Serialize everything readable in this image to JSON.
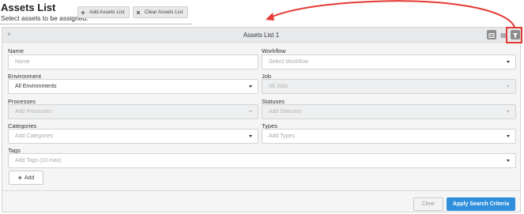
{
  "page": {
    "title": "Assets List",
    "subtitle": "Select assets to be assigned.",
    "add_assets_list_label": "Add Assets List",
    "add_glyph": "+",
    "clear_assets_list_label": "Clear Assets List",
    "clear_glyph": "×"
  },
  "panel": {
    "title": "Assets List 1",
    "close_glyph": "×",
    "fields": {
      "name": {
        "label": "Name",
        "placeholder": "Name"
      },
      "workflow": {
        "label": "Workflow",
        "placeholder": "Select Workflow"
      },
      "environment": {
        "label": "Environment",
        "value": "All Environments"
      },
      "job": {
        "label": "Job",
        "value": "All Jobs"
      },
      "processes": {
        "label": "Processes",
        "placeholder": "Add Processes"
      },
      "statuses": {
        "label": "Statuses",
        "placeholder": "Add Statuses"
      },
      "categories": {
        "label": "Categories",
        "placeholder": "Add Categories"
      },
      "types": {
        "label": "Types",
        "placeholder": "Add Types"
      },
      "tags": {
        "label": "Tags",
        "placeholder": "Add Tags (10 max)"
      }
    },
    "add_label": "Add",
    "add_glyph": "+",
    "clear_label": "Clear",
    "apply_label": "Apply Search Criteria",
    "header_icons": [
      "grid-view-icon",
      "list-view-icon",
      "filter-icon"
    ]
  },
  "colors": {
    "primary": "#2f8fdc",
    "annotation": "#e53935"
  }
}
